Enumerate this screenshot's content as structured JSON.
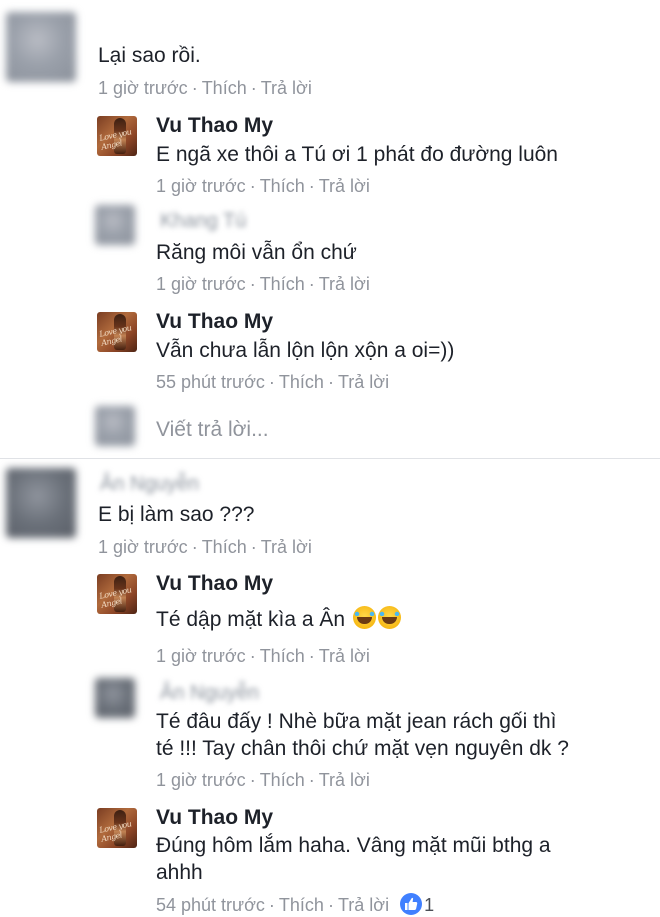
{
  "thread1": {
    "comment": {
      "text": "Lại sao rồi.",
      "meta": {
        "time": "1 giờ trước",
        "like": "Thích",
        "reply": "Trả lời"
      }
    },
    "replies": [
      {
        "author": "Vu Thao My",
        "text": "E ngã xe thôi a Tú ơi 1 phát đo đường luôn",
        "meta": {
          "time": "1 giờ trước",
          "like": "Thích",
          "reply": "Trả lời"
        }
      },
      {
        "author_blurred": "Khang Tú",
        "text": "Răng môi vẫn ổn chứ",
        "meta": {
          "time": "1 giờ trước",
          "like": "Thích",
          "reply": "Trả lời"
        }
      },
      {
        "author": "Vu Thao My",
        "text": "Vẫn chưa lẫn lộn lộn xộn a oi=))",
        "meta": {
          "time": "55 phút trước",
          "like": "Thích",
          "reply": "Trả lời"
        }
      }
    ],
    "reply_placeholder": "Viết trả lời..."
  },
  "thread2": {
    "comment": {
      "author_blurred": "Ân Nguyễn",
      "text": "E bị làm sao ???",
      "meta": {
        "time": "1 giờ trước",
        "like": "Thích",
        "reply": "Trả lời"
      }
    },
    "replies": [
      {
        "author": "Vu Thao My",
        "text": "Té dập mặt kìa a Ân",
        "emoji": "laughing-tears",
        "meta": {
          "time": "1 giờ trước",
          "like": "Thích",
          "reply": "Trả lời"
        }
      },
      {
        "author_blurred": "Ân Nguyễn",
        "text_line1": "Té đâu đấy ! Nhè bữa mặt jean rách gối thì",
        "text_line2": "té !!! Tay chân thôi chứ mặt vẹn nguyên dk ?",
        "meta": {
          "time": "1 giờ trước",
          "like": "Thích",
          "reply": "Trả lời"
        }
      },
      {
        "author": "Vu Thao My",
        "text_line1": "Đúng hôm lắm haha. Vâng mặt mũi bthg a",
        "text_line2": "ahhh",
        "meta": {
          "time": "54 phút trước",
          "like": "Thích",
          "reply": "Trả lời"
        },
        "like_count": "1"
      }
    ]
  },
  "colors": {
    "text": "#1d2129",
    "meta": "#90949c",
    "like_badge": "#4080ff"
  },
  "avatar_script": "Love you Angel"
}
